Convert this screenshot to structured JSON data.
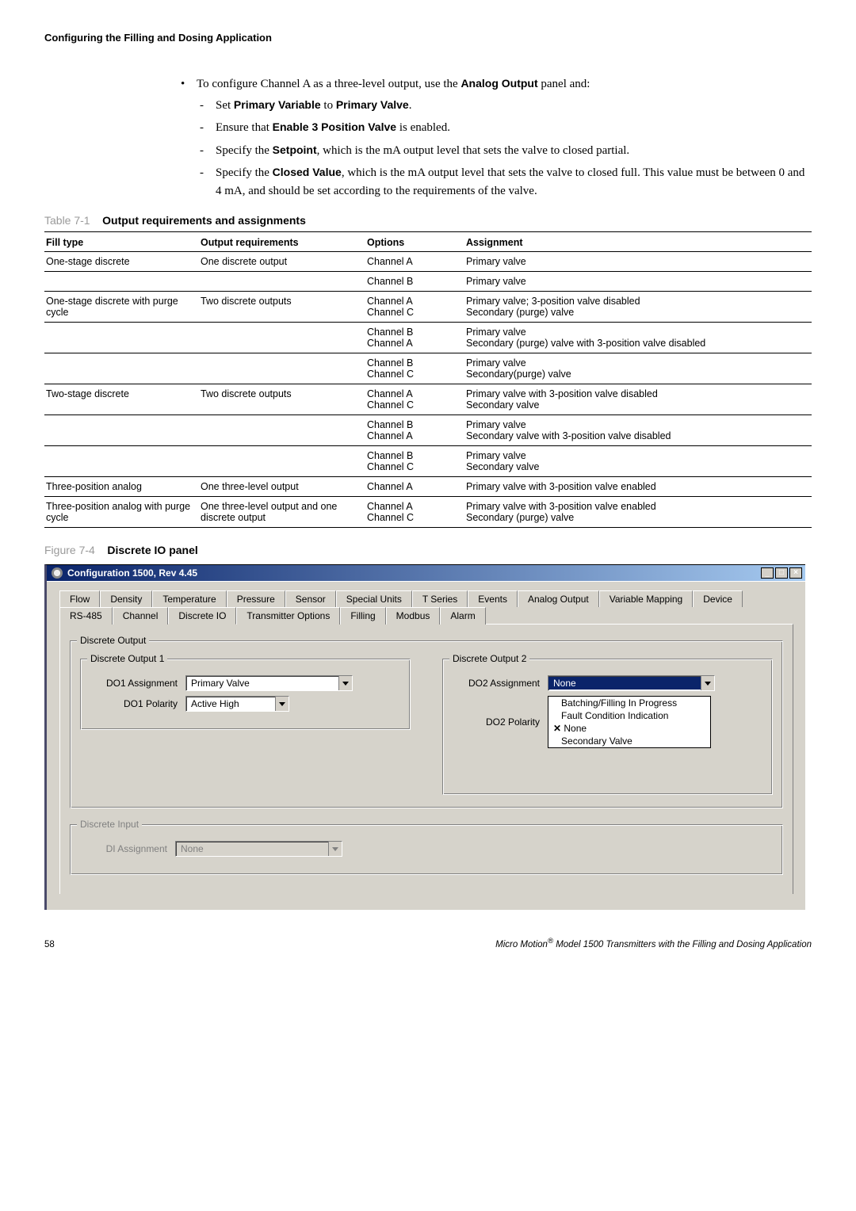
{
  "page_heading": "Configuring the Filling and Dosing Application",
  "intro": {
    "lead": "To configure Channel A as a three-level output, use the ",
    "lead_bold": "Analog Output",
    "lead_tail": " panel and:",
    "items": [
      {
        "pre": "Set ",
        "b1": "Primary Variable",
        "mid": " to ",
        "b2": "Primary Valve",
        "post": "."
      },
      {
        "pre": "Ensure that ",
        "b1": "Enable 3 Position Valve",
        "mid": "",
        "b2": "",
        "post": " is enabled."
      },
      {
        "pre": "Specify the ",
        "b1": "Setpoint",
        "mid": "",
        "b2": "",
        "post": ", which is the mA output level that sets the valve to closed partial."
      },
      {
        "pre": "Specify the ",
        "b1": "Closed Value",
        "mid": "",
        "b2": "",
        "post": ", which is the mA output level that sets the valve to closed full. This value must be between 0 and 4 mA, and should be set according to the requirements of the valve."
      }
    ]
  },
  "table": {
    "caption_label": "Table 7-1",
    "caption_title": "Output requirements and assignments",
    "headers": [
      "Fill type",
      "Output requirements",
      "Options",
      "Assignment"
    ],
    "rows": [
      {
        "ft": "One-stage discrete",
        "or": "One discrete output",
        "op": "Channel A",
        "as": "Primary valve",
        "cls": ""
      },
      {
        "ft": "",
        "or": "",
        "op": "Channel B",
        "as": "Primary valve",
        "cls": "group-end"
      },
      {
        "ft": "One-stage discrete with purge cycle",
        "or": "Two discrete outputs",
        "op": "Channel A\nChannel C",
        "as": "Primary valve; 3-position valve disabled\nSecondary (purge) valve",
        "cls": ""
      },
      {
        "ft": "",
        "or": "",
        "op": "Channel B\nChannel A",
        "as": "Primary valve\nSecondary (purge) valve with 3-position valve disabled",
        "cls": ""
      },
      {
        "ft": "",
        "or": "",
        "op": "Channel B\nChannel C",
        "as": "Primary valve\nSecondary(purge) valve",
        "cls": "group-end"
      },
      {
        "ft": "Two-stage discrete",
        "or": "Two discrete outputs",
        "op": "Channel A\nChannel C",
        "as": "Primary valve with 3-position valve disabled\nSecondary valve",
        "cls": ""
      },
      {
        "ft": "",
        "or": "",
        "op": "Channel B\nChannel A",
        "as": "Primary valve\nSecondary valve with 3-position valve disabled",
        "cls": ""
      },
      {
        "ft": "",
        "or": "",
        "op": "Channel B\nChannel C",
        "as": "Primary valve\nSecondary valve",
        "cls": "group-end"
      },
      {
        "ft": "Three-position analog",
        "or": "One three-level output",
        "op": "Channel A",
        "as": "Primary valve with 3-position valve enabled",
        "cls": "group-end"
      },
      {
        "ft": "Three-position analog with purge cycle",
        "or": "One three-level output and one discrete output",
        "op": "Channel A\nChannel C",
        "as": "Primary valve with 3-position valve enabled\nSecondary (purge) valve",
        "cls": "group-end"
      }
    ]
  },
  "figure": {
    "caption_label": "Figure 7-4",
    "caption_title": "Discrete IO panel",
    "window_title": "Configuration 1500, Rev 4.45",
    "tb": {
      "min": "_",
      "max": "□",
      "close": "×"
    },
    "tabs_row1": [
      "Flow",
      "Density",
      "Temperature",
      "Pressure",
      "Sensor",
      "Special Units",
      "T Series",
      "Events",
      "Analog Output",
      "Variable Mapping",
      "Device"
    ],
    "tabs_row2": [
      "RS-485",
      "Channel",
      "Discrete IO",
      "Transmitter Options",
      "Filling",
      "Modbus",
      "Alarm"
    ],
    "active_tab": "Discrete IO",
    "group_out": "Discrete Output",
    "group_out1": "Discrete Output 1",
    "group_out2": "Discrete Output 2",
    "do1_assign_label": "DO1 Assignment",
    "do1_assign_value": "Primary Valve",
    "do1_pol_label": "DO1 Polarity",
    "do1_pol_value": "Active High",
    "do2_assign_label": "DO2 Assignment",
    "do2_assign_value": "None",
    "do2_pol_label": "DO2 Polarity",
    "do2_pol_options": [
      {
        "text": "Batching/Filling In Progress",
        "sel": false
      },
      {
        "text": "Fault Condition Indication",
        "sel": false
      },
      {
        "text": "None",
        "sel": true
      },
      {
        "text": "Secondary Valve",
        "sel": false
      }
    ],
    "group_in": "Discrete Input",
    "di_assign_label": "DI Assignment",
    "di_assign_value": "None"
  },
  "footer": {
    "page": "58",
    "product_pre": "Micro Motion",
    "reg": "®",
    "product_post": " Model 1500 Transmitters with the Filling and Dosing Application"
  }
}
